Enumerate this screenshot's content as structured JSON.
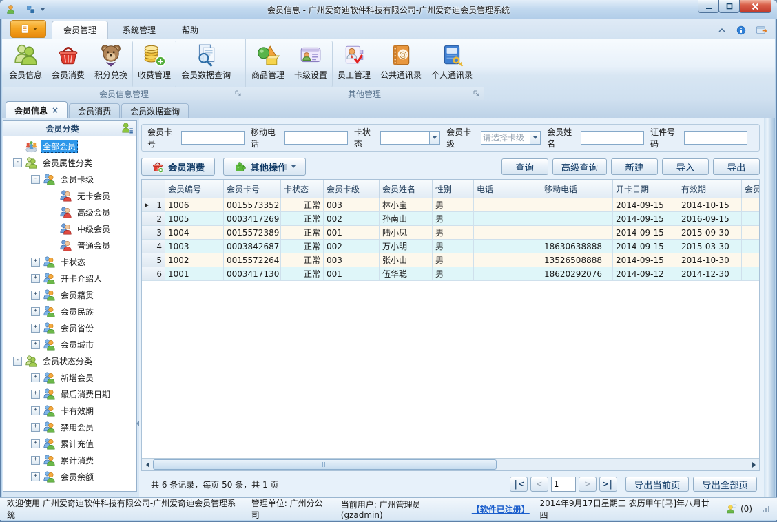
{
  "window": {
    "title": "会员信息 - 广州爱奇迪软件科技有限公司-广州爱奇迪会员管理系统"
  },
  "ribbon": {
    "tabs": [
      {
        "label": "会员管理",
        "state": "active"
      },
      {
        "label": "系统管理",
        "state": ""
      },
      {
        "label": "帮助",
        "state": ""
      }
    ],
    "groups": [
      {
        "label": "会员信息管理",
        "items": [
          {
            "label": "会员信息",
            "icon": "#i-members",
            "divider": ""
          },
          {
            "label": "会员消费",
            "icon": "#i-basket",
            "divider": ""
          },
          {
            "label": "积分兑换",
            "icon": "#i-bear",
            "divider": "divided"
          },
          {
            "label": "收费管理",
            "icon": "#i-coins",
            "divider": "divided"
          },
          {
            "label": "会员数据查询",
            "icon": "#i-searchdoc",
            "divider": ""
          }
        ]
      },
      {
        "label": "其他管理",
        "items": [
          {
            "label": "商品管理",
            "icon": "#i-goods",
            "divider": ""
          },
          {
            "label": "卡级设置",
            "icon": "#i-card",
            "divider": "divided"
          },
          {
            "label": "员工管理",
            "icon": "#i-staff",
            "divider": ""
          },
          {
            "label": "公共通讯录",
            "icon": "#i-bookA",
            "divider": ""
          },
          {
            "label": "个人通讯录",
            "icon": "#i-bookB",
            "divider": ""
          }
        ]
      }
    ]
  },
  "doc_tabs": [
    {
      "label": "会员信息",
      "state": "active",
      "close": "×"
    },
    {
      "label": "会员消费",
      "state": "",
      "close": ""
    },
    {
      "label": "会员数据查询",
      "state": "",
      "close": ""
    }
  ],
  "sidebar": {
    "title": "会员分类",
    "items": [
      {
        "indent": "lv0",
        "icon": "#t-multi",
        "exp": "",
        "label": "全部会员",
        "state": "selected"
      },
      {
        "indent": "lv0",
        "icon": "#t-green",
        "exp": "-",
        "label": "会员属性分类",
        "state": ""
      },
      {
        "indent": "lv1",
        "icon": "#t-orange",
        "exp": "-",
        "label": "会员卡级",
        "state": ""
      },
      {
        "indent": "lv2",
        "icon": "#t-red",
        "exp": "",
        "label": "无卡会员",
        "state": ""
      },
      {
        "indent": "lv2",
        "icon": "#t-red",
        "exp": "",
        "label": "高级会员",
        "state": ""
      },
      {
        "indent": "lv2",
        "icon": "#t-red",
        "exp": "",
        "label": "中级会员",
        "state": ""
      },
      {
        "indent": "lv2",
        "icon": "#t-red",
        "exp": "",
        "label": "普通会员",
        "state": ""
      },
      {
        "indent": "lv1",
        "icon": "#t-orange",
        "exp": "+",
        "label": "卡状态",
        "state": ""
      },
      {
        "indent": "lv1",
        "icon": "#t-orange",
        "exp": "+",
        "label": "开卡介绍人",
        "state": ""
      },
      {
        "indent": "lv1",
        "icon": "#t-orange",
        "exp": "+",
        "label": "会员籍贯",
        "state": ""
      },
      {
        "indent": "lv1",
        "icon": "#t-orange",
        "exp": "+",
        "label": "会员民族",
        "state": ""
      },
      {
        "indent": "lv1",
        "icon": "#t-orange",
        "exp": "+",
        "label": "会员省份",
        "state": ""
      },
      {
        "indent": "lv1",
        "icon": "#t-orange",
        "exp": "+",
        "label": "会员城市",
        "state": ""
      },
      {
        "indent": "lv0",
        "icon": "#t-green",
        "exp": "-",
        "label": "会员状态分类",
        "state": ""
      },
      {
        "indent": "lv1",
        "icon": "#t-orange",
        "exp": "+",
        "label": "新增会员",
        "state": ""
      },
      {
        "indent": "lv1",
        "icon": "#t-orange",
        "exp": "+",
        "label": "最后消费日期",
        "state": ""
      },
      {
        "indent": "lv1",
        "icon": "#t-orange",
        "exp": "+",
        "label": "卡有效期",
        "state": ""
      },
      {
        "indent": "lv1",
        "icon": "#t-orange",
        "exp": "+",
        "label": "禁用会员",
        "state": ""
      },
      {
        "indent": "lv1",
        "icon": "#t-orange",
        "exp": "+",
        "label": "累计充值",
        "state": ""
      },
      {
        "indent": "lv1",
        "icon": "#t-orange",
        "exp": "+",
        "label": "累计消费",
        "state": ""
      },
      {
        "indent": "lv1",
        "icon": "#t-orange",
        "exp": "+",
        "label": "会员余额",
        "state": ""
      }
    ]
  },
  "search": {
    "fields": [
      {
        "label": "会员卡号",
        "kind": "text",
        "placeholder": ""
      },
      {
        "label": "移动电话",
        "kind": "text",
        "placeholder": ""
      },
      {
        "label": "卡状态",
        "kind": "combo",
        "placeholder": ""
      },
      {
        "label": "会员卡级",
        "kind": "combo",
        "placeholder": "请选择卡级"
      },
      {
        "label": "会员姓名",
        "kind": "text",
        "placeholder": ""
      },
      {
        "label": "证件号码",
        "kind": "text",
        "placeholder": ""
      }
    ]
  },
  "toolbar": {
    "consume_label": "会员消费",
    "other_label": "其他操作",
    "right_buttons": [
      {
        "label": "查询"
      },
      {
        "label": "高级查询"
      },
      {
        "label": "新建"
      },
      {
        "label": "导入"
      },
      {
        "label": "导出"
      }
    ]
  },
  "grid": {
    "columns": [
      "",
      "会员编号",
      "会员卡号",
      "卡状态",
      "会员卡级",
      "会员姓名",
      "性别",
      "电话",
      "移动电话",
      "开卡日期",
      "有效期",
      "会员"
    ],
    "rows": [
      {
        "marker": "▶",
        "num": "1",
        "id": "1006",
        "card": "0015573352",
        "status": "正常",
        "level": "003",
        "name": "林小宝",
        "gender": "男",
        "phone": "",
        "mobile": "",
        "open": "2014-09-15",
        "valid": "2014-10-15",
        "extra": "",
        "tone": "cream"
      },
      {
        "marker": "",
        "num": "2",
        "id": "1005",
        "card": "0003417269",
        "status": "正常",
        "level": "002",
        "name": "孙南山",
        "gender": "男",
        "phone": "",
        "mobile": "",
        "open": "2014-09-15",
        "valid": "2016-09-15",
        "extra": "",
        "tone": "cyan"
      },
      {
        "marker": "",
        "num": "3",
        "id": "1004",
        "card": "0015572389",
        "status": "正常",
        "level": "001",
        "name": "陆小凤",
        "gender": "男",
        "phone": "",
        "mobile": "",
        "open": "2014-09-15",
        "valid": "2015-09-30",
        "extra": "",
        "tone": "cream"
      },
      {
        "marker": "",
        "num": "4",
        "id": "1003",
        "card": "0003842687",
        "status": "正常",
        "level": "002",
        "name": "万小明",
        "gender": "男",
        "phone": "",
        "mobile": "18630638888",
        "open": "2014-09-15",
        "valid": "2015-03-30",
        "extra": "",
        "tone": "cyan"
      },
      {
        "marker": "",
        "num": "5",
        "id": "1002",
        "card": "0015572264",
        "status": "正常",
        "level": "003",
        "name": "张小山",
        "gender": "男",
        "phone": "",
        "mobile": "13526508888",
        "open": "2014-09-15",
        "valid": "2014-10-30",
        "extra": "",
        "tone": "cream"
      },
      {
        "marker": "",
        "num": "6",
        "id": "1001",
        "card": "0003417130",
        "status": "正常",
        "level": "001",
        "name": "伍华聪",
        "gender": "男",
        "phone": "",
        "mobile": "18620292076",
        "open": "2014-09-12",
        "valid": "2014-12-30",
        "extra": "",
        "tone": "cyan"
      }
    ]
  },
  "pager": {
    "summary": "共 6 条记录，每页 50 条，共 1 页",
    "first": "|<",
    "prev": "<",
    "page": "1",
    "next": ">",
    "last": ">|",
    "export_current": "导出当前页",
    "export_all": "导出全部页"
  },
  "statusbar": {
    "welcome": "欢迎使用 广州爱奇迪软件科技有限公司-广州爱奇迪会员管理系统",
    "org": "管理单位: 广州分公司",
    "user": "当前用户: 广州管理员(gzadmin)",
    "registered": "【软件已注册】",
    "date": "2014年9月17日星期三 农历甲午[马]年八月廿四",
    "msg_count": "(0)"
  },
  "colors": {
    "accent_orange": "#f5a623",
    "row_cream": "#fdf8ec",
    "row_cyan": "#dff6f9",
    "selection_blue": "#2e97ea",
    "close_red": "#c0392b"
  }
}
